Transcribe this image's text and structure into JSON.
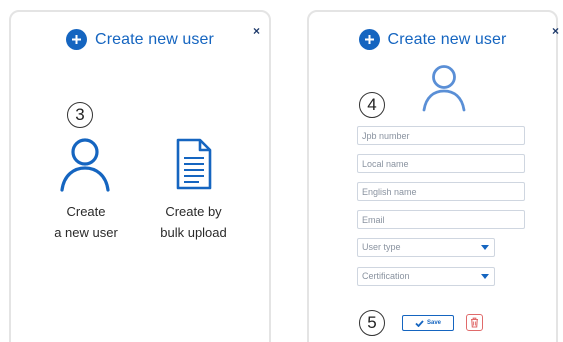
{
  "left_panel": {
    "title": "Create new user",
    "close_glyph": "×",
    "step_number": "3",
    "option_single": {
      "line1": "Create",
      "line2": "a new user",
      "icon": "user-icon"
    },
    "option_bulk": {
      "line1": "Create by",
      "line2": "bulk upload",
      "icon": "document-icon"
    }
  },
  "right_panel": {
    "title": "Create new user",
    "close_glyph": "×",
    "step_number_form": "4",
    "step_number_actions": "5",
    "avatar_icon": "user-icon",
    "fields": {
      "job_number": {
        "placeholder": "Jpb number"
      },
      "local_name": {
        "placeholder": "Local name"
      },
      "english_name": {
        "placeholder": "English name"
      },
      "email": {
        "placeholder": "Email"
      }
    },
    "selects": {
      "user_type": {
        "value": "User type"
      },
      "certification": {
        "value": "Certification"
      }
    },
    "save_label": "Save",
    "delete_icon": "trash-icon"
  },
  "colors": {
    "accent": "#1565c0",
    "border": "#e4e4e4",
    "danger": "#e06a6a"
  }
}
